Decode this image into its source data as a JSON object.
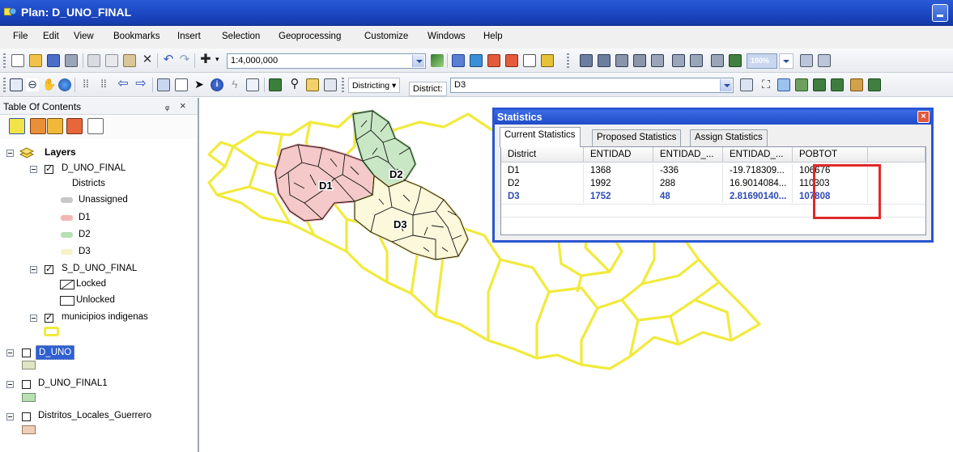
{
  "window": {
    "title": "Plan: D_UNO_FINAL"
  },
  "menu": [
    "File",
    "Edit",
    "View",
    "Bookmarks",
    "Insert",
    "Selection",
    "Geoprocessing",
    "Customize",
    "Windows",
    "Help"
  ],
  "toolbar": {
    "scale": "1:4,000,000",
    "zoom": "100%",
    "districting_label": "Districting",
    "district_label": "District:",
    "district_value": "D3"
  },
  "toc": {
    "title": "Table Of Contents",
    "pin": "ᵩ",
    "close": "×",
    "root": "Layers",
    "layers": [
      {
        "name": "D_UNO_FINAL",
        "checked": true
      },
      {
        "name": "Districts"
      },
      {
        "name": "Unassigned",
        "color": "#c8c8c8"
      },
      {
        "name": "D1",
        "color": "#f2b6b6"
      },
      {
        "name": "D2",
        "color": "#b7dfb3"
      },
      {
        "name": "D3",
        "color": "#f6f3c8"
      },
      {
        "name": "S_D_UNO_FINAL",
        "checked": true
      },
      {
        "name": "Locked"
      },
      {
        "name": "Unlocked"
      },
      {
        "name": "municipios indigenas",
        "checked": true,
        "color": "#f2ea3a"
      },
      {
        "name": "D_UNO",
        "checked": false,
        "color": "#dfe5c4"
      },
      {
        "name": "D_UNO_FINAL1",
        "checked": false,
        "color": "#b8e0b4"
      },
      {
        "name": "Distritos_Locales_Guerrero",
        "checked": false,
        "color": "#efcdb6"
      }
    ]
  },
  "map": {
    "labels": [
      "D1",
      "D2",
      "D3"
    ],
    "colors": {
      "outline": "#f1ea3c",
      "d1": "#f5c9c9",
      "d2": "#c9e6c5",
      "d3": "#fbf8dc"
    }
  },
  "stats": {
    "title": "Statistics",
    "close": "×",
    "tabs": [
      "Current Statistics",
      "Proposed Statistics",
      "Assign Statistics"
    ],
    "columns": [
      "District",
      "ENTIDAD",
      "ENTIDAD_...",
      "ENTIDAD_...",
      "POBTOT"
    ],
    "rows": [
      [
        "D1",
        "1368",
        "-336",
        "-19.718309...",
        "106676"
      ],
      [
        "D2",
        "1992",
        "288",
        "16.9014084...",
        "110303"
      ],
      [
        "D3",
        "1752",
        "48",
        "2.81690140...",
        "107808"
      ]
    ]
  }
}
